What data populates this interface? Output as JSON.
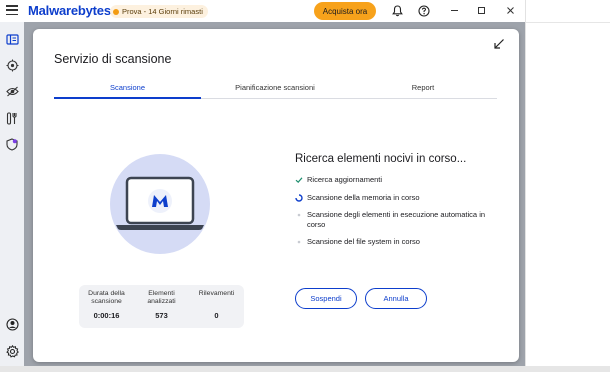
{
  "app": {
    "brand": "Malwarebytes",
    "trial_badge": "Prova - 14 Giorni rimasti",
    "buy_button": "Acquista ora",
    "window_controls": [
      "minimize",
      "maximize",
      "close"
    ]
  },
  "modal": {
    "title": "Servizio di scansione",
    "tabs": [
      {
        "label": "Scansione",
        "active": true
      },
      {
        "label": "Pianificazione scansioni",
        "active": false
      },
      {
        "label": "Report",
        "active": false
      }
    ],
    "heading": "Ricerca elementi nocivi in corso...",
    "steps": [
      {
        "label": "Ricerca aggiornamenti",
        "status": "done"
      },
      {
        "label": "Scansione della memoria in corso",
        "status": "in-progress"
      },
      {
        "label": "Scansione degli elementi in esecuzione automatica in corso",
        "status": "pending"
      },
      {
        "label": "Scansione del file system in corso",
        "status": "pending"
      }
    ],
    "stats": [
      {
        "label": "Durata della scansione",
        "value": "0:00:16"
      },
      {
        "label": "Elementi analizzati",
        "value": "573"
      },
      {
        "label": "Rilevamenti",
        "value": "0"
      }
    ],
    "buttons": {
      "pause": "Sospendi",
      "cancel": "Annulla"
    }
  },
  "icons": {
    "sidebar": [
      "dashboard-icon",
      "scanner-icon",
      "privacy-icon",
      "tools-icon",
      "shield-icon",
      "account-icon",
      "settings-icon"
    ],
    "topbar": [
      "notification-bell-icon",
      "help-icon"
    ]
  },
  "colors": {
    "accent": "#0d3ecc",
    "buy": "#f7a21b",
    "trial_bg": "#fdf1df",
    "check": "#1e8e6e"
  }
}
